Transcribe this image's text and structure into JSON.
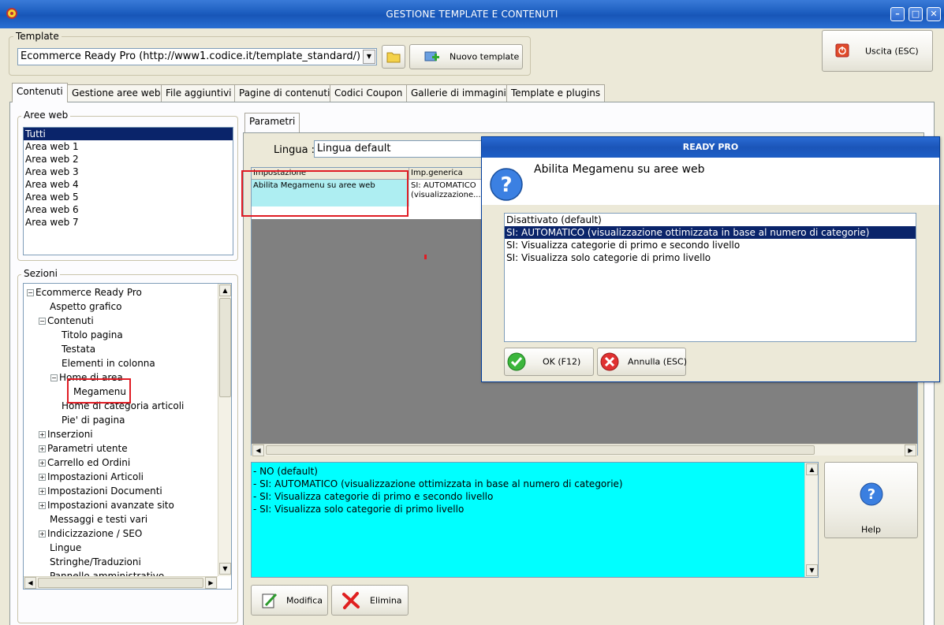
{
  "window": {
    "title": "GESTIONE TEMPLATE E CONTENUTI",
    "minimize": "–",
    "maximize": "□",
    "close": "✕"
  },
  "template": {
    "group_label": "Template",
    "selected": "Ecommerce Ready Pro (http://www1.codice.it/template_standard/)",
    "new_button": "Nuovo template"
  },
  "exit_button": "Uscita (ESC)",
  "tabs": [
    {
      "label": "Contenuti",
      "active": true
    },
    {
      "label": "Gestione aree web"
    },
    {
      "label": "File aggiuntivi"
    },
    {
      "label": "Pagine di contenuti"
    },
    {
      "label": "Codici Coupon"
    },
    {
      "label": "Gallerie di immagini"
    },
    {
      "label": "Template e plugins"
    }
  ],
  "aree_web": {
    "label": "Aree web",
    "items": [
      "Tutti",
      "Area web 1",
      "Area web 2",
      "Area web 3",
      "Area web 4",
      "Area web 5",
      "Area web 6",
      "Area web 7"
    ],
    "selected_index": 0
  },
  "sezioni": {
    "label": "Sezioni",
    "items": [
      {
        "text": "Ecommerce Ready Pro",
        "level": 0,
        "exp": "−"
      },
      {
        "text": "Aspetto grafico",
        "level": 1
      },
      {
        "text": "Contenuti",
        "level": 1,
        "exp": "−"
      },
      {
        "text": "Titolo pagina",
        "level": 2
      },
      {
        "text": "Testata",
        "level": 2
      },
      {
        "text": "Elementi in colonna",
        "level": 2
      },
      {
        "text": "Home di area",
        "level": 2,
        "exp": "−"
      },
      {
        "text": "Megamenu",
        "level": 3
      },
      {
        "text": "Home di categoria articoli",
        "level": 2
      },
      {
        "text": "Pie' di pagina",
        "level": 2
      },
      {
        "text": "Inserzioni",
        "level": 1,
        "exp": "+"
      },
      {
        "text": "Parametri utente",
        "level": 1,
        "exp": "+"
      },
      {
        "text": "Carrello ed Ordini",
        "level": 1,
        "exp": "+"
      },
      {
        "text": "Impostazioni Articoli",
        "level": 1,
        "exp": "+"
      },
      {
        "text": "Impostazioni Documenti",
        "level": 1,
        "exp": "+"
      },
      {
        "text": "Impostazioni avanzate sito",
        "level": 1,
        "exp": "+"
      },
      {
        "text": "Messaggi e testi vari",
        "level": 1
      },
      {
        "text": "Indicizzazione / SEO",
        "level": 1,
        "exp": "+"
      },
      {
        "text": "Lingue",
        "level": 1
      },
      {
        "text": "Stringhe/Traduzioni",
        "level": 1
      },
      {
        "text": "Pannello amministrativo",
        "level": 1
      }
    ]
  },
  "parametri": {
    "tab_label": "Parametri",
    "lingua_label": "Lingua :",
    "lingua_value": "Lingua default",
    "col_impostazione": "Impostazione",
    "col_generica": "Imp.generica",
    "row_impostazione": "Abilita Megamenu su aree web",
    "row_generica_1": "SI: AUTOMATICO",
    "row_generica_2": "(visualizzazione..."
  },
  "options_text": [
    "- NO (default)",
    "- SI: AUTOMATICO (visualizzazione ottimizzata in base al numero di categorie)",
    "- SI: Visualizza categorie di primo e secondo livello",
    "- SI: Visualizza solo categorie di primo livello"
  ],
  "help_button": "Help",
  "modifica_button": "Modifica",
  "elimina_button": "Elimina",
  "dialog": {
    "title": "READY PRO",
    "question": "Abilita Megamenu su aree web",
    "options": [
      "Disattivato (default)",
      "SI: AUTOMATICO (visualizzazione ottimizzata in base al numero di categorie)",
      "SI: Visualizza categorie di primo e secondo livello",
      "SI: Visualizza solo categorie di primo livello"
    ],
    "selected_index": 1,
    "ok_button": "OK (F12)",
    "cancel_button": "Annulla (ESC)"
  },
  "colors": {
    "selection": "#0a246a",
    "highlight_box": "#e01c24",
    "cyan": "#00ffff",
    "title_blue": "#1c5dbf"
  }
}
